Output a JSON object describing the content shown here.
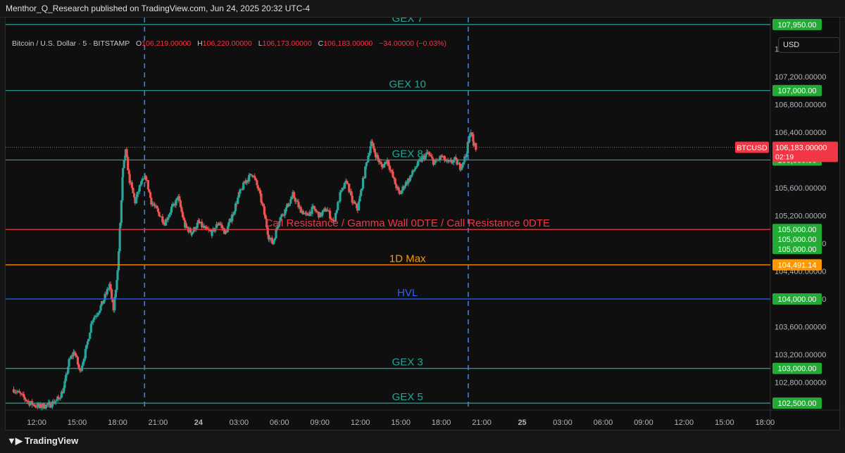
{
  "header": {
    "publisher": "Menthor_Q_Research published on TradingView.com, Jun 24, 2025 20:32 UTC-4"
  },
  "legend": {
    "symbol": "Bitcoin / U.S. Dollar · 5 · BITSTAMP",
    "open_label": "O",
    "open": "106,219.00000",
    "high_label": "H",
    "high": "106,220.00000",
    "low_label": "L",
    "low": "106,173.00000",
    "close_label": "C",
    "close": "106,183.00000",
    "change": "−34.00000 (−0.03%)"
  },
  "currency": "USD",
  "footer": {
    "brand": "TradingView"
  },
  "colors": {
    "teal": "#26a69a",
    "red": "#f23645",
    "orange": "#ff9800",
    "blue": "#2962ff",
    "green": "#22ab35"
  },
  "chart_data": {
    "type": "candlestick",
    "symbol": "BTCUSD",
    "interval": "5",
    "ylim": [
      102400,
      108050
    ],
    "y_ticks": [
      {
        "value": 107600,
        "label": "107,600.00000"
      },
      {
        "value": 107200,
        "label": "107,200.00000"
      },
      {
        "value": 106800,
        "label": "106,800.00000"
      },
      {
        "value": 106400,
        "label": "106,400.00000"
      },
      {
        "value": 105600,
        "label": "105,600.00000"
      },
      {
        "value": 105200,
        "label": "105,200.00000"
      },
      {
        "value": 104800,
        "label": "104,800.00000"
      },
      {
        "value": 104400,
        "label": "104,400.00000"
      },
      {
        "value": 104000,
        "label": "104,000.00000"
      },
      {
        "value": 103600,
        "label": "103,600.00000"
      },
      {
        "value": 103200,
        "label": "103,200.00000"
      },
      {
        "value": 102800,
        "label": "102,800.00000"
      }
    ],
    "x_ticks": [
      {
        "hour": 12,
        "label": "12:00"
      },
      {
        "hour": 15,
        "label": "15:00"
      },
      {
        "hour": 18,
        "label": "18:00"
      },
      {
        "hour": 21,
        "label": "21:00"
      },
      {
        "hour": 24,
        "label": "24",
        "bold": true
      },
      {
        "hour": 27,
        "label": "03:00"
      },
      {
        "hour": 30,
        "label": "06:00"
      },
      {
        "hour": 33,
        "label": "09:00"
      },
      {
        "hour": 36,
        "label": "12:00"
      },
      {
        "hour": 39,
        "label": "15:00"
      },
      {
        "hour": 42,
        "label": "18:00"
      },
      {
        "hour": 45,
        "label": "21:00"
      },
      {
        "hour": 48,
        "label": "25",
        "bold": true
      },
      {
        "hour": 51,
        "label": "03:00"
      },
      {
        "hour": 54,
        "label": "06:00"
      },
      {
        "hour": 57,
        "label": "09:00"
      },
      {
        "hour": 60,
        "label": "12:00"
      },
      {
        "hour": 63,
        "label": "15:00"
      },
      {
        "hour": 66,
        "label": "18:00"
      }
    ],
    "x_range_hours": [
      9.7,
      66.4
    ],
    "vertical_markers_hours": [
      20.0,
      44.0
    ],
    "levels": [
      {
        "name": "GEX 7",
        "value": 107950,
        "color": "#26a69a",
        "tag": "107,950.00",
        "label_hour": 39.5
      },
      {
        "name": "GEX 10",
        "value": 107000,
        "color": "#26a69a",
        "tag": "107,000.00",
        "label_hour": 39.5
      },
      {
        "name": "GEX 8",
        "value": 106000,
        "color": "#26a69a",
        "tag": "106,000.00",
        "label_hour": 39.5
      },
      {
        "name": "Call Resistance /  Gamma Wall 0DTE /  Call Resistance 0DTE",
        "value": 105000,
        "color": "#f23645",
        "tag": "105,000.00",
        "label_hour": 39.5
      },
      {
        "name": "1D Max",
        "value": 104491.14,
        "color": "#ff9800",
        "tag": "104,491.14",
        "label_hour": 39.5
      },
      {
        "name": "HVL",
        "value": 104000,
        "color": "#2962ff",
        "tag": "104,000.00",
        "label_hour": 39.5
      },
      {
        "name": "GEX 3",
        "value": 103000,
        "color": "#26a69a",
        "tag": "103,000.00",
        "label_hour": 39.5
      },
      {
        "name": "GEX 5",
        "value": 102500,
        "color": "#26a69a",
        "tag": "102,500.00",
        "label_hour": 39.5
      }
    ],
    "stacked_tags": [
      "105,000.00",
      "105,000.00"
    ],
    "last_price": {
      "value": 106183,
      "symbol": "BTCUSD",
      "price": "106,183.00000",
      "countdown": "02:19"
    },
    "price_path": [
      [
        10.3,
        102700
      ],
      [
        10.8,
        102620
      ],
      [
        11.5,
        102500
      ],
      [
        12.2,
        102450
      ],
      [
        13.0,
        102480
      ],
      [
        13.6,
        102560
      ],
      [
        14.0,
        102700
      ],
      [
        14.4,
        103100
      ],
      [
        14.8,
        103250
      ],
      [
        15.2,
        102950
      ],
      [
        15.7,
        103300
      ],
      [
        16.1,
        103700
      ],
      [
        16.5,
        103800
      ],
      [
        16.9,
        103950
      ],
      [
        17.4,
        104200
      ],
      [
        17.7,
        103850
      ],
      [
        18.0,
        104400
      ],
      [
        18.2,
        105100
      ],
      [
        18.4,
        105850
      ],
      [
        18.6,
        106120
      ],
      [
        18.9,
        105700
      ],
      [
        19.3,
        105400
      ],
      [
        19.7,
        105650
      ],
      [
        20.1,
        105750
      ],
      [
        20.5,
        105400
      ],
      [
        21.0,
        105250
      ],
      [
        21.5,
        105100
      ],
      [
        22.0,
        105300
      ],
      [
        22.5,
        105450
      ],
      [
        23.0,
        105050
      ],
      [
        23.5,
        104950
      ],
      [
        24.0,
        105100
      ],
      [
        24.5,
        105000
      ],
      [
        25.0,
        104950
      ],
      [
        25.5,
        105100
      ],
      [
        26.0,
        104950
      ],
      [
        26.5,
        105200
      ],
      [
        27.0,
        105500
      ],
      [
        27.5,
        105700
      ],
      [
        28.0,
        105800
      ],
      [
        28.4,
        105600
      ],
      [
        28.8,
        105300
      ],
      [
        29.2,
        104900
      ],
      [
        29.5,
        104800
      ],
      [
        30.0,
        105150
      ],
      [
        30.5,
        105300
      ],
      [
        31.0,
        105500
      ],
      [
        31.5,
        105300
      ],
      [
        32.0,
        105200
      ],
      [
        32.5,
        105300
      ],
      [
        33.0,
        105200
      ],
      [
        33.5,
        105300
      ],
      [
        34.0,
        105100
      ],
      [
        34.5,
        105500
      ],
      [
        35.0,
        105700
      ],
      [
        35.4,
        105400
      ],
      [
        35.8,
        105300
      ],
      [
        36.2,
        105700
      ],
      [
        36.5,
        106000
      ],
      [
        36.8,
        106250
      ],
      [
        37.2,
        106050
      ],
      [
        37.6,
        105900
      ],
      [
        38.0,
        106000
      ],
      [
        38.5,
        105700
      ],
      [
        38.9,
        105500
      ],
      [
        39.3,
        105650
      ],
      [
        39.7,
        105750
      ],
      [
        40.1,
        105900
      ],
      [
        40.5,
        106000
      ],
      [
        41.0,
        106100
      ],
      [
        41.5,
        105950
      ],
      [
        42.0,
        106050
      ],
      [
        42.5,
        105950
      ],
      [
        43.0,
        106000
      ],
      [
        43.4,
        105900
      ],
      [
        43.8,
        106050
      ],
      [
        44.0,
        106250
      ],
      [
        44.2,
        106420
      ],
      [
        44.4,
        106220
      ],
      [
        44.6,
        106183
      ]
    ]
  }
}
